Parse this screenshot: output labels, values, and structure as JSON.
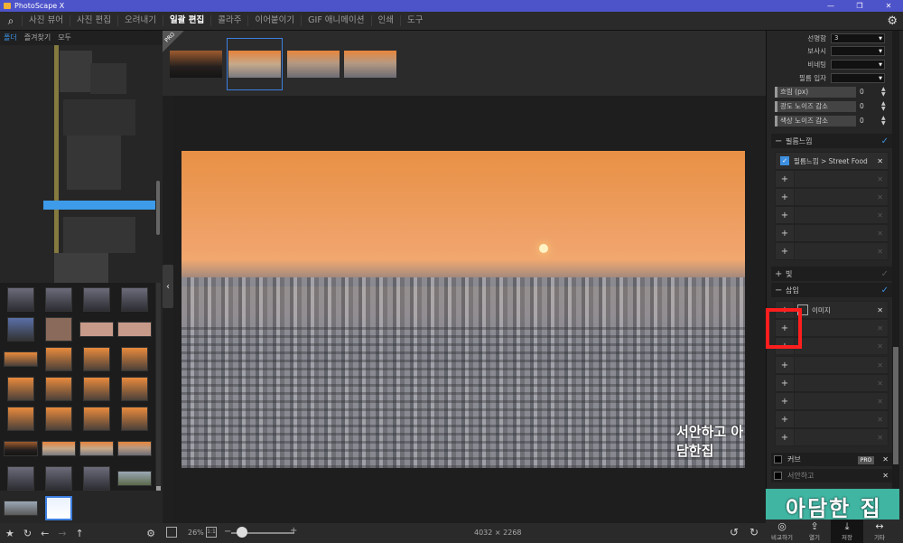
{
  "window": {
    "title": "PhotoScape X",
    "controls": [
      "—",
      "❐",
      "✕"
    ]
  },
  "menu": {
    "items": [
      {
        "label": "사진 뷰어",
        "active": false
      },
      {
        "label": "사진 편집",
        "active": false
      },
      {
        "label": "오려내기",
        "active": false
      },
      {
        "label": "일괄 편집",
        "active": true
      },
      {
        "label": "콜라주",
        "active": false
      },
      {
        "label": "이어붙이기",
        "active": false
      },
      {
        "label": "GIF 애니메이션",
        "active": false
      },
      {
        "label": "인쇄",
        "active": false
      },
      {
        "label": "도구",
        "active": false
      }
    ]
  },
  "left_panel": {
    "tabs": [
      "폴더",
      "즐겨찾기",
      "모두"
    ],
    "toolbar_icons": [
      "star-icon",
      "refresh-icon",
      "back-icon",
      "forward-icon",
      "up-icon",
      "gear-icon"
    ]
  },
  "filmstrip": {
    "badge": "PRO"
  },
  "viewer": {
    "zoom": "26%",
    "one_to_one": "1:1",
    "dimensions": "4032 × 2268",
    "watermark": "서안하고 아담한집"
  },
  "right_panel": {
    "selects": [
      {
        "label": "선명함",
        "value": "3"
      },
      {
        "label": "보사시",
        "value": ""
      },
      {
        "label": "비네팅",
        "value": ""
      },
      {
        "label": "필름 입자",
        "value": ""
      }
    ],
    "sliders": [
      {
        "label": "흐림 (px)",
        "value": "0"
      },
      {
        "label": "광도 노이즈 감소",
        "value": "0"
      },
      {
        "label": "색상 노이즈 감소",
        "value": "0"
      }
    ],
    "film_section": "필름느낌",
    "film_item": "필름느낌 > Street Food",
    "light_section": "빛",
    "insert_section": "삽입",
    "insert_item": "이미지",
    "curve_label": "커브",
    "pro_badge": "PRO",
    "ad_text": "아담한 집",
    "ad_sub": "서안하고",
    "bottom_buttons": [
      {
        "label": "비교하기",
        "icon": "compare-icon"
      },
      {
        "label": "열기",
        "icon": "open-icon"
      },
      {
        "label": "저장",
        "icon": "save-icon"
      },
      {
        "label": "기타",
        "icon": "more-icon"
      }
    ]
  }
}
